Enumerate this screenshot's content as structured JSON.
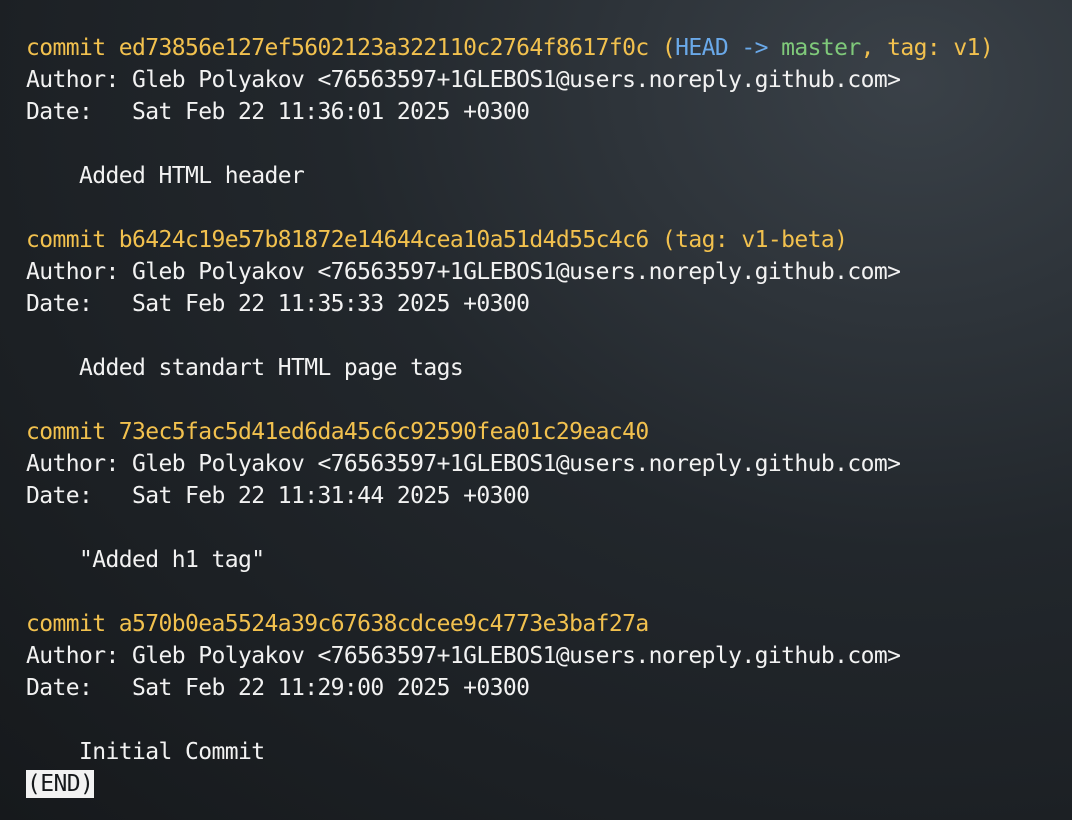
{
  "commits": [
    {
      "prefix": "commit ",
      "hash": "ed73856e127ef5602123a322110c2764f8617f0c",
      "refs_open": " (",
      "head": "HEAD ->",
      "branch": " master",
      "refs_rest": ", tag: v1)",
      "author": "Author: Gleb Polyakov <76563597+1GLEBOS1@users.noreply.github.com>",
      "date": "Date:   Sat Feb 22 11:36:01 2025 +0300",
      "message": "    Added HTML header"
    },
    {
      "prefix": "commit ",
      "hash": "b6424c19e57b81872e14644cea10a51d4d55c4c6",
      "refs": " (tag: v1-beta)",
      "author": "Author: Gleb Polyakov <76563597+1GLEBOS1@users.noreply.github.com>",
      "date": "Date:   Sat Feb 22 11:35:33 2025 +0300",
      "message": "    Added standart HTML page tags"
    },
    {
      "prefix": "commit ",
      "hash": "73ec5fac5d41ed6da45c6c92590fea01c29eac40",
      "author": "Author: Gleb Polyakov <76563597+1GLEBOS1@users.noreply.github.com>",
      "date": "Date:   Sat Feb 22 11:31:44 2025 +0300",
      "message": "    \"Added h1 tag\""
    },
    {
      "prefix": "commit ",
      "hash": "a570b0ea5524a39c67638cdcee9c4773e3baf27a",
      "author": "Author: Gleb Polyakov <76563597+1GLEBOS1@users.noreply.github.com>",
      "date": "Date:   Sat Feb 22 11:29:00 2025 +0300",
      "message": "    Initial Commit"
    }
  ],
  "pager": {
    "end_label": "(END)"
  },
  "colors": {
    "commit_line": "#f2c14e",
    "head_ref": "#6aa9e9",
    "branch_ref": "#7fc97a",
    "text": "#f2f2f2"
  }
}
